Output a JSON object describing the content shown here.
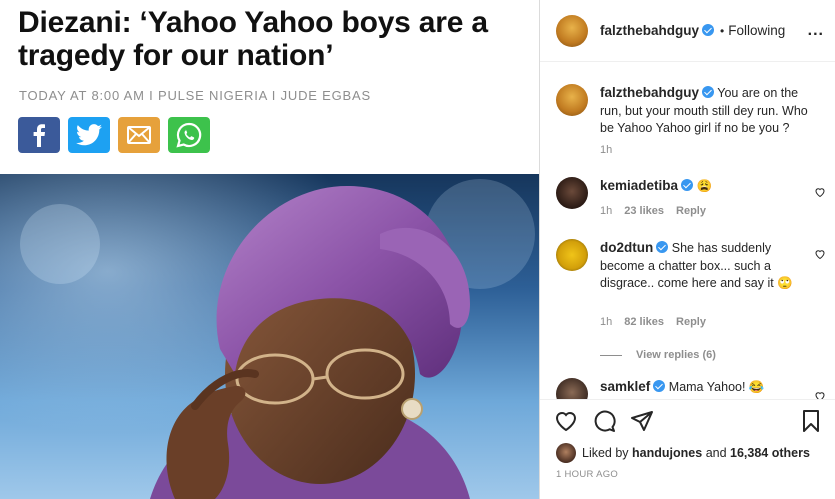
{
  "article": {
    "headline": "Diezani: ‘Yahoo Yahoo boys are a tragedy for our nation’",
    "byline": "TODAY AT 8:00 AM I PULSE NIGERIA I JUDE EGBAS",
    "share_buttons": [
      {
        "name": "facebook",
        "color": "#3b5a9a"
      },
      {
        "name": "twitter",
        "color": "#1da1f2"
      },
      {
        "name": "email",
        "color": "#e6a13b"
      },
      {
        "name": "whatsapp",
        "color": "#3dc24c"
      }
    ]
  },
  "post": {
    "author": "falzthebahdguy",
    "separator": "•",
    "follow_status": "Following",
    "more": "...",
    "caption": {
      "user": "falzthebahdguy",
      "text": "You are on the run, but your mouth still dey run. Who be Yahoo Yahoo girl if no be you ?",
      "time": "1h"
    },
    "comments": [
      {
        "user": "kemiadetiba",
        "text": "😩",
        "time": "1h",
        "likes": "23 likes",
        "reply": "Reply"
      },
      {
        "user": "do2dtun",
        "text": "She has suddenly become a chatter box... such a disgrace.. come here and say it 🙄",
        "time": "1h",
        "likes": "82 likes",
        "reply": "Reply"
      },
      {
        "user": "samklef",
        "text": "Mama Yahoo! 😂"
      }
    ],
    "view_replies": "View replies (6)",
    "liked_by_prefix": "Liked by",
    "liked_by_user": "handujones",
    "liked_by_and": "and",
    "liked_by_count": "16,384 others",
    "time_ago": "1 HOUR AGO"
  },
  "colors": {
    "verified": "#3897f0",
    "muted_text": "#8e8e8e",
    "text": "#262626"
  }
}
